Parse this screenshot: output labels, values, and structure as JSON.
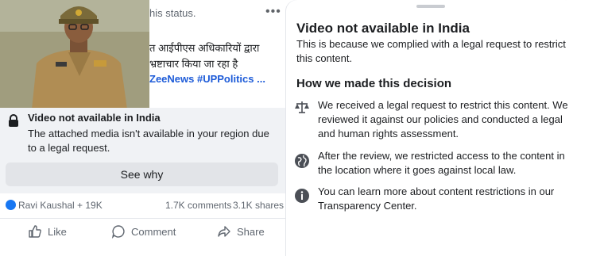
{
  "post": {
    "snippet_line1": "his status.",
    "snippet_line2": "त आईपीएस अधिकारियों द्वारा",
    "snippet_line3": "भ्रष्टाचार किया जा रहा है",
    "snippet_tags": "ZeeNews #UPPolitics ...",
    "more_label": "•••"
  },
  "restriction": {
    "title": "Video not available in India",
    "body": "The attached media isn't available in your region due to a legal request.",
    "button": "See why"
  },
  "reactions": {
    "summary": "Ravi Kaushal + 19K",
    "comments": "1.7K comments",
    "shares": "3.1K shares"
  },
  "actions": {
    "like": "Like",
    "comment": "Comment",
    "share": "Share"
  },
  "sheet": {
    "title": "Video not available in India",
    "subtitle": "This is because we complied with a legal request to restrict this content.",
    "heading": "How we made this decision",
    "reasons": [
      {
        "icon": "scales-icon",
        "text": "We received a legal request to restrict this content. We reviewed it against our policies and conducted a legal and human rights assessment."
      },
      {
        "icon": "globe-icon",
        "text": "After the review, we restricted access to the content in the location where it goes against local law."
      },
      {
        "icon": "info-icon",
        "text": "You can learn more about content restrictions in our Transparency Center."
      }
    ]
  },
  "colors": {
    "card_bg": "#f0f2f5",
    "button_bg": "#e2e4e8",
    "link_blue": "#1d5bd8",
    "reaction_blue": "#1877f2"
  }
}
